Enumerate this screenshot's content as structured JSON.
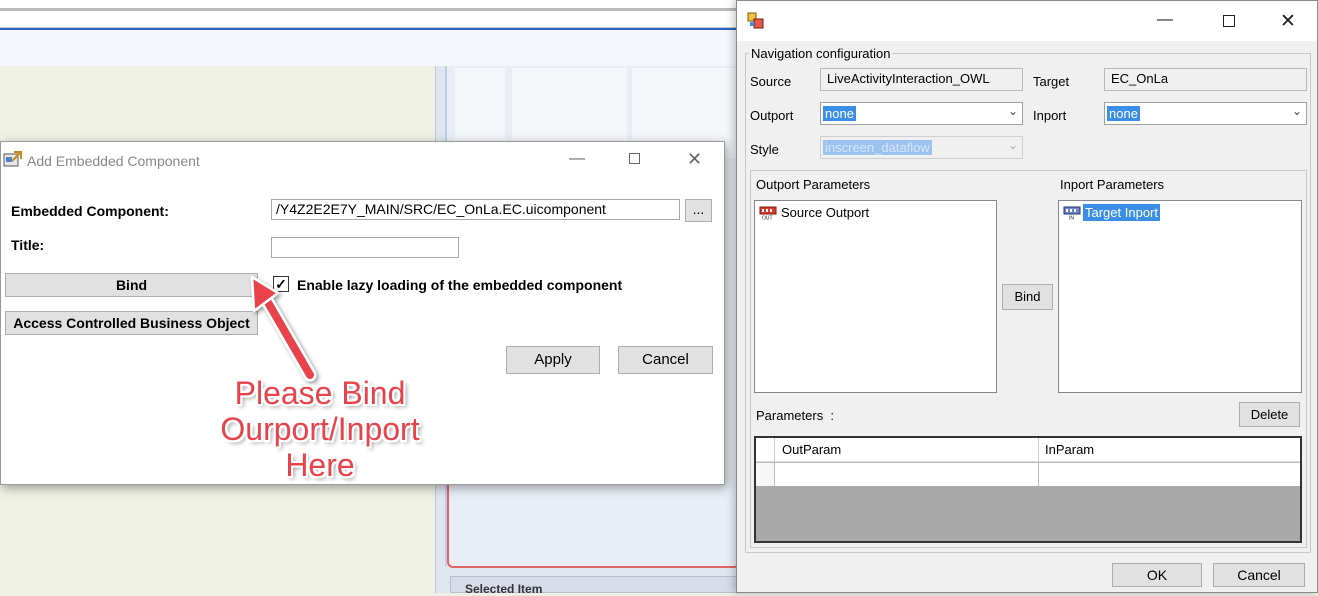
{
  "add_embedded_component": {
    "title": "Add Embedded Component",
    "embedded_component_label": "Embedded Component:",
    "embedded_component_value": "/Y4Z2E2E7Y_MAIN/SRC/EC_OnLa.EC.uicomponent",
    "browse_label": "...",
    "title_label": "Title:",
    "title_value": "",
    "bind_label": "Bind",
    "access_controlled_label": "Access Controlled Business Object",
    "lazy_loading_label": "Enable lazy loading of the embedded component",
    "lazy_loading_checked": true,
    "apply_label": "Apply",
    "cancel_label": "Cancel"
  },
  "annotation": {
    "line1": "Please Bind",
    "line2": "Ourport/Inport",
    "line3": "Here",
    "color": "#e8424b"
  },
  "background": {
    "selected_item_label": "Selected Item"
  },
  "navigation_configuration": {
    "group_title": "Navigation configuration",
    "source_label": "Source",
    "source_value": "LiveActivityInteraction_OWL",
    "target_label": "Target",
    "target_value": "EC_OnLa",
    "outport_label": "Outport",
    "outport_value": "none",
    "inport_label": "Inport",
    "inport_value": "none",
    "style_label": "Style",
    "style_value": "inscreen_dataflow",
    "outport_params_label": "Outport Parameters",
    "inport_params_label": "Inport Parameters",
    "outport_items": [
      "Source Outport"
    ],
    "inport_items": [
      "Target Inport"
    ],
    "bind_label": "Bind",
    "parameters_label": "Parameters",
    "delete_label": "Delete",
    "grid_columns": [
      "OutParam",
      "InParam"
    ],
    "ok_label": "OK",
    "cancel_label": "Cancel"
  },
  "colors": {
    "selection": "#3a8ee6",
    "annotation": "#e8424b",
    "frame_highlight": "#e06464"
  }
}
